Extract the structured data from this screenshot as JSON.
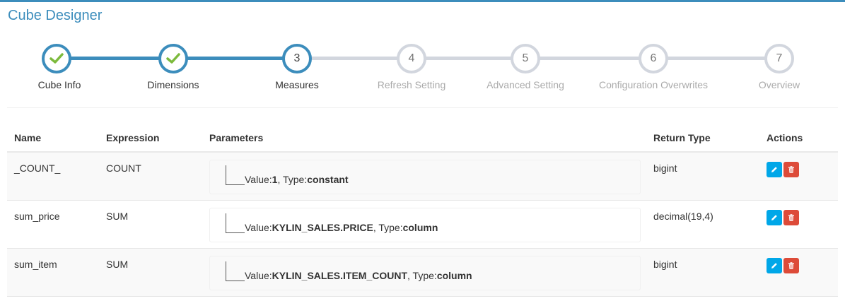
{
  "app": {
    "title": "Cube Designer"
  },
  "wizard": {
    "steps": [
      {
        "number": "1",
        "label": "Cube Info",
        "state": "done"
      },
      {
        "number": "2",
        "label": "Dimensions",
        "state": "done"
      },
      {
        "number": "3",
        "label": "Measures",
        "state": "active"
      },
      {
        "number": "4",
        "label": "Refresh Setting",
        "state": "todo"
      },
      {
        "number": "5",
        "label": "Advanced Setting",
        "state": "todo"
      },
      {
        "number": "6",
        "label": "Configuration Overwrites",
        "state": "todo"
      },
      {
        "number": "7",
        "label": "Overview",
        "state": "todo"
      }
    ]
  },
  "table": {
    "headers": {
      "name": "Name",
      "expression": "Expression",
      "parameters": "Parameters",
      "return_type": "Return Type",
      "actions": "Actions"
    },
    "rows": [
      {
        "name": "_COUNT_",
        "expression": "COUNT",
        "param_value_label": "Value:",
        "param_value": "1",
        "param_type_label": ", Type:",
        "param_type": "constant",
        "return_type": "bigint"
      },
      {
        "name": "sum_price",
        "expression": "SUM",
        "param_value_label": "Value:",
        "param_value": "KYLIN_SALES.PRICE",
        "param_type_label": ", Type:",
        "param_type": "column",
        "return_type": "decimal(19,4)"
      },
      {
        "name": "sum_item",
        "expression": "SUM",
        "param_value_label": "Value:",
        "param_value": "KYLIN_SALES.ITEM_COUNT",
        "param_type_label": ", Type:",
        "param_type": "column",
        "return_type": "bigint"
      }
    ]
  },
  "icons": {
    "step_done": "check-icon",
    "edit": "pencil-icon",
    "delete": "trash-icon"
  },
  "colors": {
    "accent": "#3c8dbc",
    "check": "#7cba3c",
    "inactive": "#d2d6de",
    "edit_button": "#00a7e8",
    "delete_button": "#dd4b39"
  }
}
